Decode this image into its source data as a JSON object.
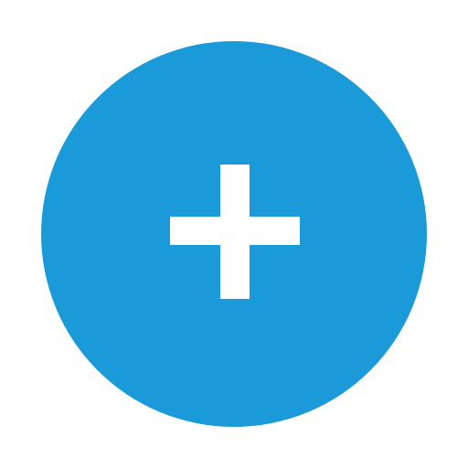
{
  "button": {
    "icon": "plus-icon",
    "color": "#1a9ad8",
    "icon_color": "#ffffff"
  }
}
